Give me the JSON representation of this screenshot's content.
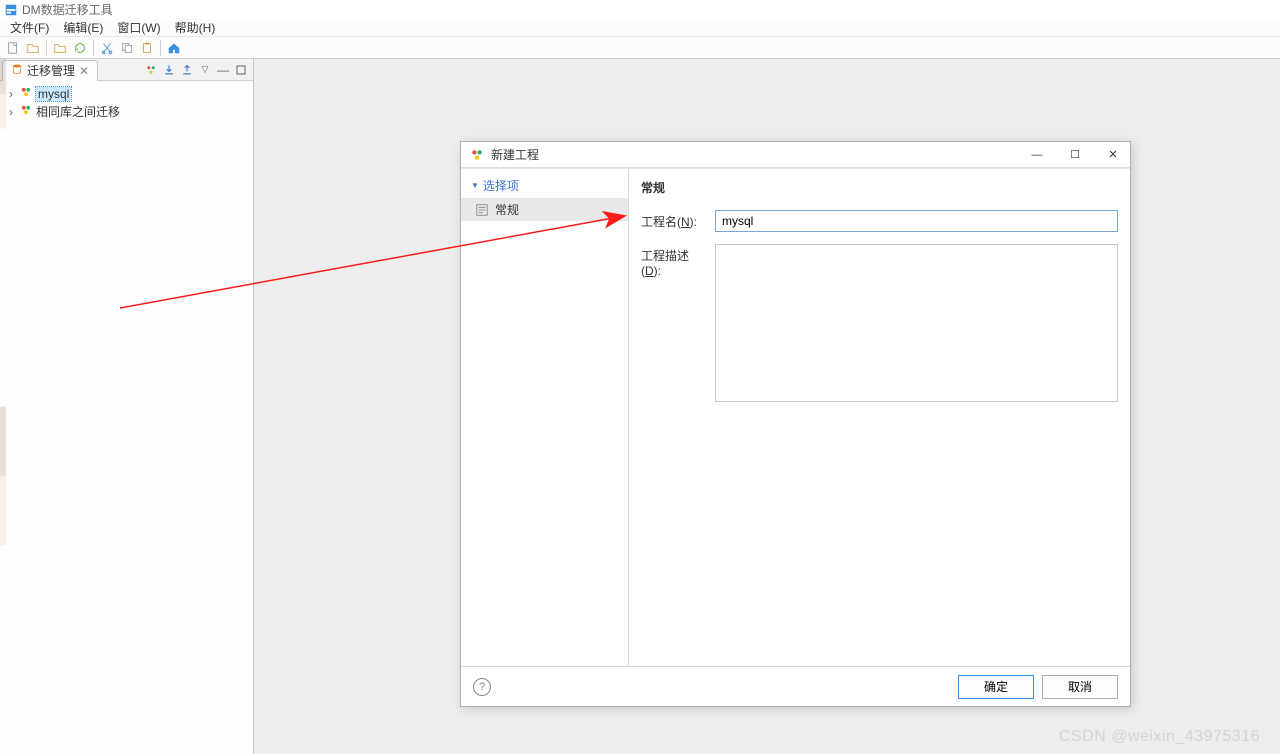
{
  "app": {
    "title": "DM数据迁移工具"
  },
  "menu": {
    "file": "文件(F)",
    "edit": "编辑(E)",
    "window": "窗口(W)",
    "help": "帮助(H)"
  },
  "side": {
    "tab_label": "迁移管理",
    "tree": [
      {
        "label": "mysql",
        "selected": true
      },
      {
        "label": "相同库之间迁移",
        "selected": false
      }
    ]
  },
  "dialog": {
    "title": "新建工程",
    "side": {
      "header": "选择项",
      "item": "常规"
    },
    "section_title": "常规",
    "form": {
      "name_label_prefix": "工程名(",
      "name_label_u": "N",
      "name_label_suffix": "):",
      "name_value": "mysql",
      "desc_label_prefix": "工程描述(",
      "desc_label_u": "D",
      "desc_label_suffix": "):",
      "desc_value": ""
    },
    "buttons": {
      "ok": "确定",
      "cancel": "取消"
    }
  },
  "watermark": "CSDN @weixin_43975316"
}
